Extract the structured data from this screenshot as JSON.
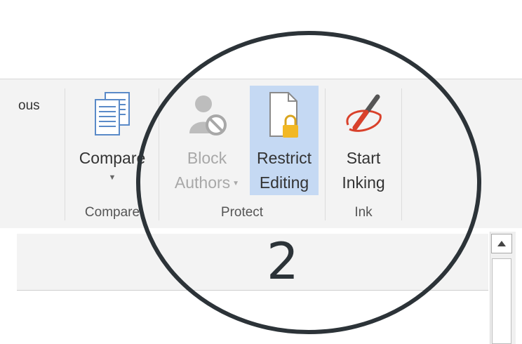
{
  "ribbon": {
    "previous_group_label": "ous",
    "compare": {
      "button_label": "Compare",
      "group_label": "Compare"
    },
    "protect": {
      "block_authors": {
        "line1": "Block",
        "line2": "Authors"
      },
      "restrict_editing": {
        "line1": "Restrict",
        "line2": "Editing"
      },
      "group_label": "Protect"
    },
    "ink": {
      "start_inking": {
        "line1": "Start",
        "line2": "Inking"
      },
      "group_label": "Ink"
    }
  },
  "annotation": {
    "number": "2"
  },
  "colors": {
    "highlight": "#c5d9f3",
    "ink_red": "#d9412b",
    "circle_stroke": "#2c3338"
  },
  "icons": [
    "compare-icon",
    "block-authors-icon",
    "restrict-editing-icon",
    "start-inking-icon",
    "scroll-up-icon"
  ]
}
